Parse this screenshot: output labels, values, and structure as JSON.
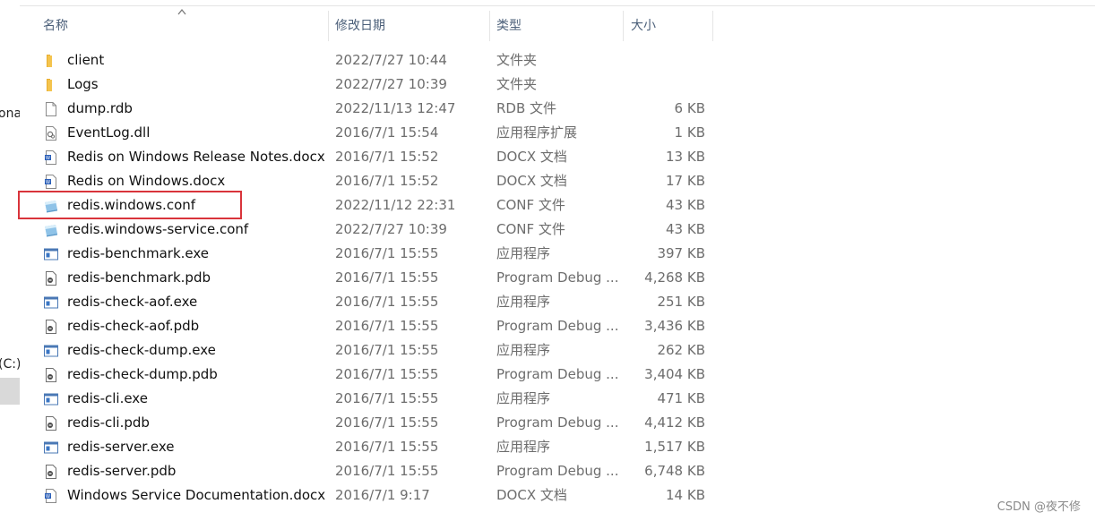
{
  "nav": {
    "partial_item_top": "ona",
    "partial_item_drive": "(C:)"
  },
  "columns": {
    "name": "名称",
    "modified": "修改日期",
    "type": "类型",
    "size": "大小"
  },
  "files": [
    {
      "name": "client",
      "modified": "2022/7/27 10:44",
      "type": "文件夹",
      "size": "",
      "icon": "folder-icon"
    },
    {
      "name": "Logs",
      "modified": "2022/7/27 10:39",
      "type": "文件夹",
      "size": "",
      "icon": "folder-icon"
    },
    {
      "name": "dump.rdb",
      "modified": "2022/11/13 12:47",
      "type": "RDB 文件",
      "size": "6 KB",
      "icon": "blank-file-icon"
    },
    {
      "name": "EventLog.dll",
      "modified": "2016/7/1 15:54",
      "type": "应用程序扩展",
      "size": "1 KB",
      "icon": "dll-file-icon"
    },
    {
      "name": "Redis on Windows Release Notes.docx",
      "modified": "2016/7/1 15:52",
      "type": "DOCX 文档",
      "size": "13 KB",
      "icon": "docx-file-icon"
    },
    {
      "name": "Redis on Windows.docx",
      "modified": "2016/7/1 15:52",
      "type": "DOCX 文档",
      "size": "17 KB",
      "icon": "docx-file-icon"
    },
    {
      "name": "redis.windows.conf",
      "modified": "2022/11/12 22:31",
      "type": "CONF 文件",
      "size": "43 KB",
      "icon": "conf-file-icon"
    },
    {
      "name": "redis.windows-service.conf",
      "modified": "2022/7/27 10:39",
      "type": "CONF 文件",
      "size": "43 KB",
      "icon": "conf-file-icon"
    },
    {
      "name": "redis-benchmark.exe",
      "modified": "2016/7/1 15:55",
      "type": "应用程序",
      "size": "397 KB",
      "icon": "exe-file-icon"
    },
    {
      "name": "redis-benchmark.pdb",
      "modified": "2016/7/1 15:55",
      "type": "Program Debug ...",
      "size": "4,268 KB",
      "icon": "pdb-file-icon"
    },
    {
      "name": "redis-check-aof.exe",
      "modified": "2016/7/1 15:55",
      "type": "应用程序",
      "size": "251 KB",
      "icon": "exe-file-icon"
    },
    {
      "name": "redis-check-aof.pdb",
      "modified": "2016/7/1 15:55",
      "type": "Program Debug ...",
      "size": "3,436 KB",
      "icon": "pdb-file-icon"
    },
    {
      "name": "redis-check-dump.exe",
      "modified": "2016/7/1 15:55",
      "type": "应用程序",
      "size": "262 KB",
      "icon": "exe-file-icon"
    },
    {
      "name": "redis-check-dump.pdb",
      "modified": "2016/7/1 15:55",
      "type": "Program Debug ...",
      "size": "3,404 KB",
      "icon": "pdb-file-icon"
    },
    {
      "name": "redis-cli.exe",
      "modified": "2016/7/1 15:55",
      "type": "应用程序",
      "size": "471 KB",
      "icon": "exe-file-icon"
    },
    {
      "name": "redis-cli.pdb",
      "modified": "2016/7/1 15:55",
      "type": "Program Debug ...",
      "size": "4,412 KB",
      "icon": "pdb-file-icon"
    },
    {
      "name": "redis-server.exe",
      "modified": "2016/7/1 15:55",
      "type": "应用程序",
      "size": "1,517 KB",
      "icon": "exe-file-icon"
    },
    {
      "name": "redis-server.pdb",
      "modified": "2016/7/1 15:55",
      "type": "Program Debug ...",
      "size": "6,748 KB",
      "icon": "pdb-file-icon"
    },
    {
      "name": "Windows Service Documentation.docx",
      "modified": "2016/7/1 9:17",
      "type": "DOCX 文档",
      "size": "14 KB",
      "icon": "docx-file-icon"
    }
  ],
  "highlighted_file": "redis.windows.conf",
  "watermark": "CSDN @夜不修",
  "colors": {
    "highlight_border": "#d9343b",
    "header_text": "#4c607a",
    "folder": "#f4c44e"
  }
}
